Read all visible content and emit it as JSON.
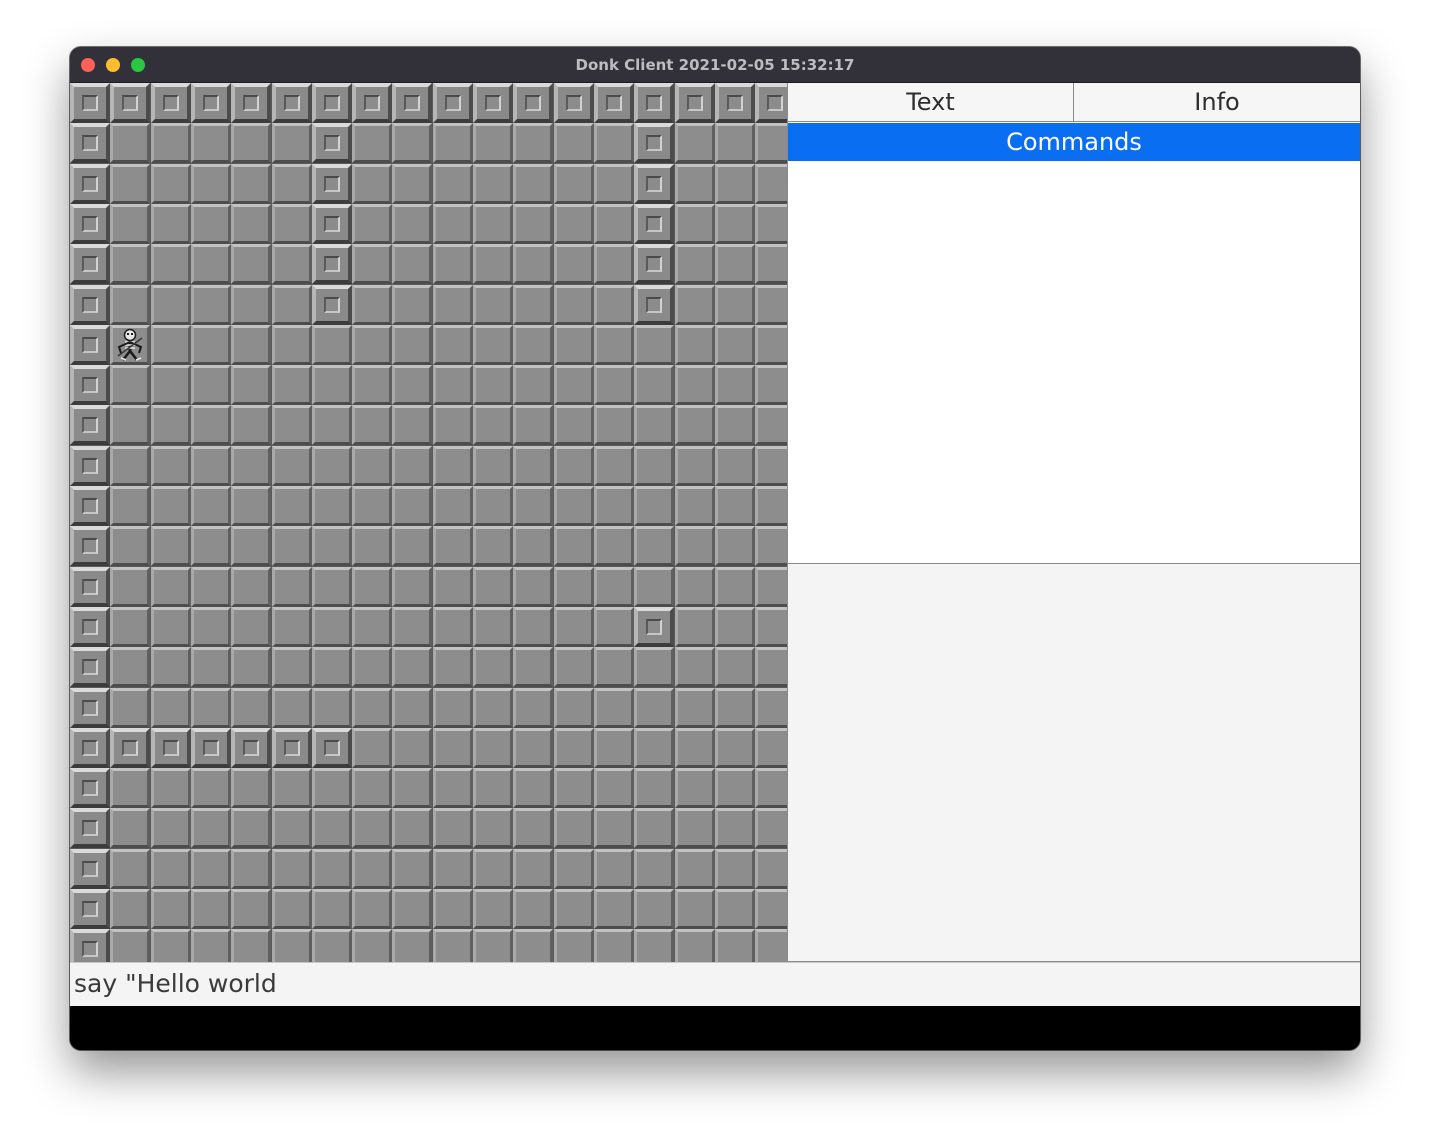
{
  "window": {
    "title": "Donk Client 2021-02-05 15:32:17"
  },
  "map": {
    "tile_icon": "stone-floor-tile",
    "wall_icon": "stone-wall-block",
    "player_icon": "skeleton-player-sprite"
  },
  "side_panel": {
    "tabs": [
      "Text",
      "Info",
      "Commands"
    ],
    "selected_tab": "Commands",
    "accent_color": "#0a6ef2"
  },
  "command_input": {
    "value": "say \"Hello world"
  }
}
